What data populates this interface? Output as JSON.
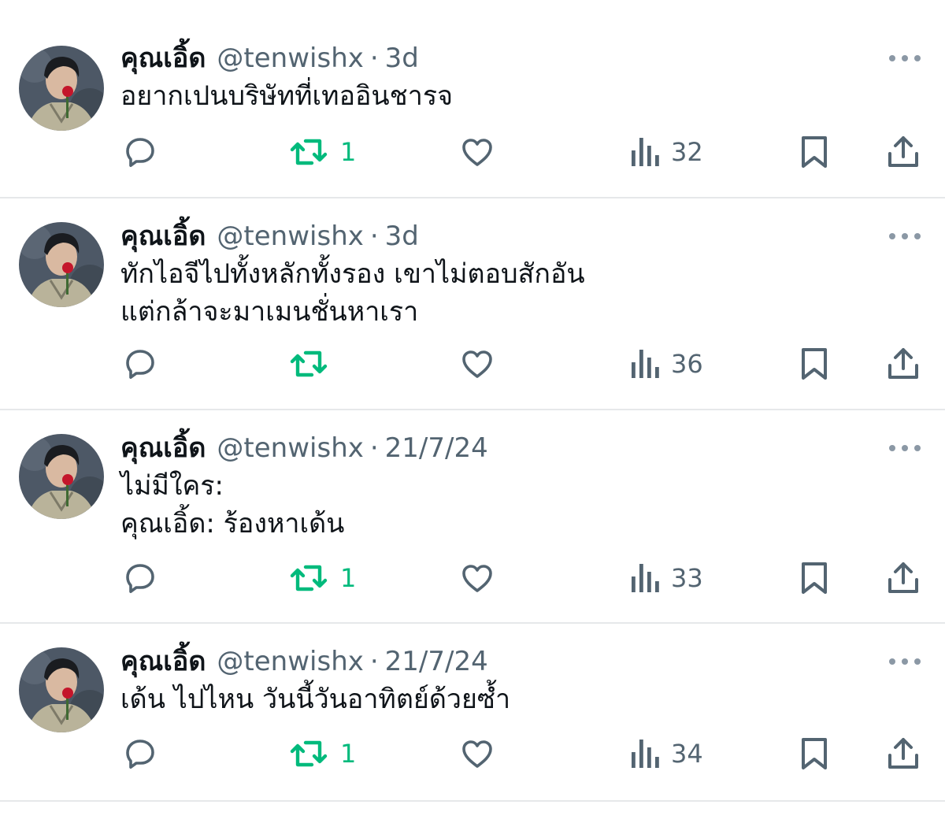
{
  "tweets": [
    {
      "name": "คุณเอิ้ด",
      "handle": "@tenwishx",
      "dot": "·",
      "time": "3d",
      "text": "อยากเปนบริษัทที่เทออินชารจ",
      "replies": "",
      "retweets": "1",
      "likes": "",
      "views": "32"
    },
    {
      "name": "คุณเอิ้ด",
      "handle": "@tenwishx",
      "dot": "·",
      "time": "3d",
      "text": "ทักไอจีไปทั้งหลักทั้งรอง เขาไม่ตอบสักอัน\nแต่กล้าจะมาเมนชั่นหาเรา",
      "replies": "",
      "retweets": "",
      "likes": "",
      "views": "36"
    },
    {
      "name": "คุณเอิ้ด",
      "handle": "@tenwishx",
      "dot": "·",
      "time": "21/7/24",
      "text": "ไม่มีใคร:\nคุณเอิ้ด: ร้องหาเด้น",
      "replies": "",
      "retweets": "1",
      "likes": "",
      "views": "33"
    },
    {
      "name": "คุณเอิ้ด",
      "handle": "@tenwishx",
      "dot": "·",
      "time": "21/7/24",
      "text": "เด้น ไปไหน วันนี้วันอาทิตย์ด้วยซ้ำ",
      "replies": "",
      "retweets": "1",
      "likes": "",
      "views": "34"
    }
  ],
  "icons": {
    "reply": "reply-icon",
    "retweet": "retweet-icon",
    "like": "heart-icon",
    "views": "views-icon",
    "bookmark": "bookmark-icon",
    "share": "share-icon",
    "more": "more-icon",
    "avatar": "avatar"
  },
  "colors": {
    "text": "#0f1419",
    "muted": "#536471",
    "icon": "#536471",
    "retweet_active": "#00ba7c",
    "divider": "#e6e8ea"
  }
}
